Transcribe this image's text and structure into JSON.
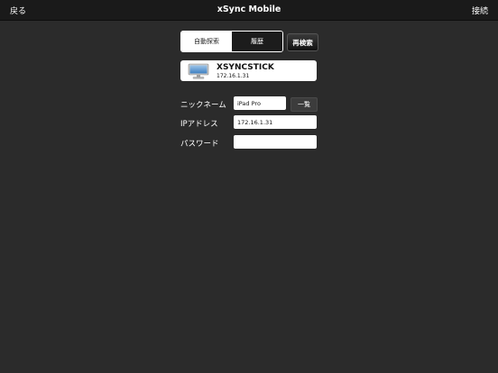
{
  "nav": {
    "back": "戻る",
    "title": "xSync Mobile",
    "connect": "接続"
  },
  "segment": {
    "auto": "自動探索",
    "history": "履歴"
  },
  "rescan": "再検索",
  "device": {
    "name": "XSYNCSTICK",
    "ip": "172.16.1.31"
  },
  "form": {
    "nickname_label": "ニックネーム",
    "nickname_value": "iPad Pro",
    "list_button": "一覧",
    "ip_label": "IPアドレス",
    "ip_value": "172.16.1.31",
    "password_label": "パスワード",
    "password_value": ""
  },
  "colors": {
    "background": "#2b2b2b",
    "navbar": "#1a1a1a",
    "card": "#ffffff"
  },
  "icons": {
    "device": "monitor-icon"
  }
}
